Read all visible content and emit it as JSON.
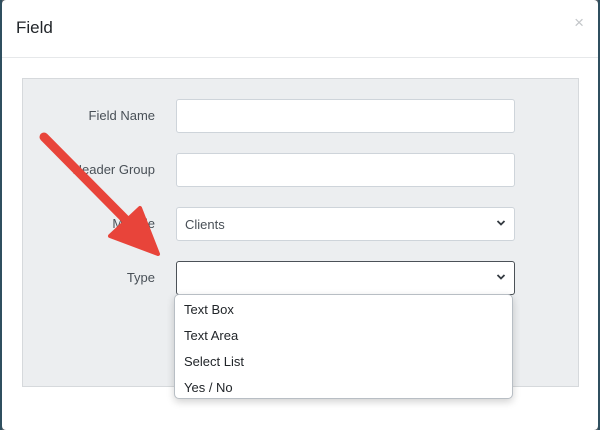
{
  "modal": {
    "title": "Field",
    "close_symbol": "×"
  },
  "form": {
    "field_name": {
      "label": "Field Name",
      "value": ""
    },
    "header_group": {
      "label": "Header Group",
      "value": ""
    },
    "module": {
      "label": "Module",
      "value": "Clients"
    },
    "type": {
      "label": "Type",
      "value": ""
    }
  },
  "dropdown": {
    "options": [
      "Text Box",
      "Text Area",
      "Select List",
      "Yes / No"
    ]
  },
  "annotation": {
    "arrow_color": "#e8443a"
  },
  "icons": {
    "close": "close-icon",
    "chevron": "chevron-down-icon"
  }
}
